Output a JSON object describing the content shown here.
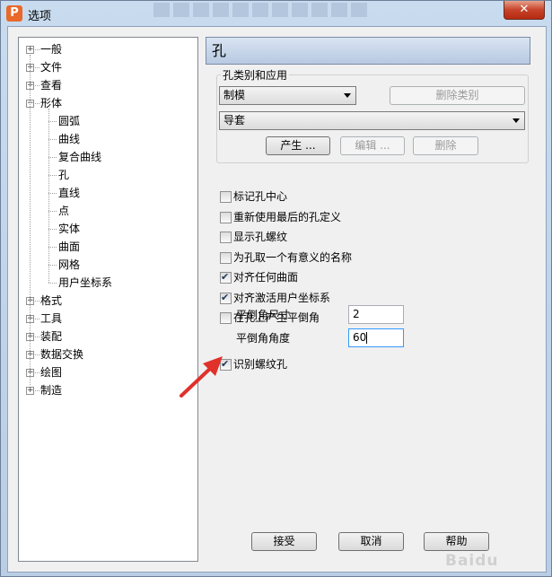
{
  "window": {
    "title": "选项",
    "app_icon": "P",
    "close_label": "✕"
  },
  "tree": {
    "items": [
      {
        "label": "一般",
        "expander": "+"
      },
      {
        "label": "文件",
        "expander": "+"
      },
      {
        "label": "查看",
        "expander": "+"
      },
      {
        "label": "形体",
        "expander": "−"
      },
      {
        "label": "圆弧"
      },
      {
        "label": "曲线"
      },
      {
        "label": "复合曲线"
      },
      {
        "label": "孔"
      },
      {
        "label": "直线"
      },
      {
        "label": "点"
      },
      {
        "label": "实体"
      },
      {
        "label": "曲面"
      },
      {
        "label": "网格"
      },
      {
        "label": "用户坐标系"
      },
      {
        "label": "格式",
        "expander": "+"
      },
      {
        "label": "工具",
        "expander": "+"
      },
      {
        "label": "装配",
        "expander": "+"
      },
      {
        "label": "数据交换",
        "expander": "+"
      },
      {
        "label": "绘图",
        "expander": "+"
      },
      {
        "label": "制造",
        "expander": "+"
      }
    ]
  },
  "panel": {
    "title": "孔",
    "group_label": "孔类别和应用",
    "category_select": "制模",
    "delete_category": "删除类别",
    "app_select": "导套",
    "produce": "产生 ...",
    "edit": "编辑 ...",
    "delete": "删除"
  },
  "options": [
    {
      "label": "标记孔中心",
      "checked": false
    },
    {
      "label": "重新使用最后的孔定义",
      "checked": false
    },
    {
      "label": "显示孔螺纹",
      "checked": false
    },
    {
      "label": "为孔取一个有意义的名称",
      "checked": false
    },
    {
      "label": "对齐任何曲面",
      "checked": true
    },
    {
      "label": "对齐激活用户坐标系",
      "checked": true
    },
    {
      "label": "在孔上产生平倒角",
      "checked": false
    }
  ],
  "chamfer": {
    "size_label": "平倒角尺寸",
    "size_value": "2",
    "angle_label": "平倒角角度",
    "angle_value": "60"
  },
  "thread_option": {
    "label": "识别螺纹孔",
    "checked": true
  },
  "buttons": {
    "ok": "接受",
    "cancel": "取消",
    "help": "帮助"
  },
  "colors": {
    "annotation_arrow": "#e0312b",
    "header_bg": "#c6d6ea"
  }
}
